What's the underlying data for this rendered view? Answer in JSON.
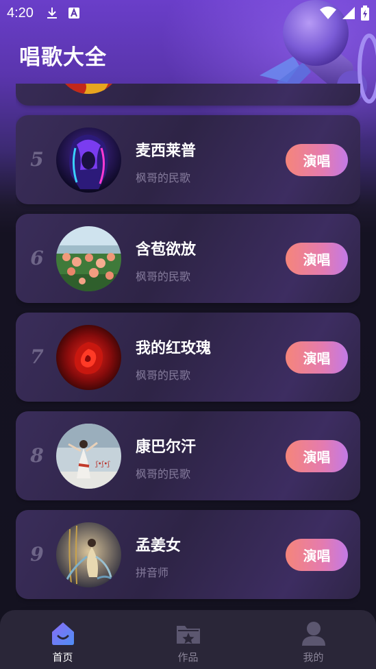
{
  "status_bar": {
    "time": "4:20",
    "left_icons": [
      "download-icon",
      "a11y-icon"
    ],
    "right_icons": [
      "wifi-icon",
      "signal-icon",
      "battery-icon"
    ]
  },
  "app": {
    "title": "唱歌大全"
  },
  "songs": [
    {
      "rank": "5",
      "title": "麦西莱普",
      "artist": "枫哥的民歌",
      "button": "演唱",
      "cover": "neon-portrait-cover"
    },
    {
      "rank": "6",
      "title": "含苞欲放",
      "artist": "枫哥的民歌",
      "button": "演唱",
      "cover": "rose-garden-cover"
    },
    {
      "rank": "7",
      "title": "我的红玫瑰",
      "artist": "枫哥的民歌",
      "button": "演唱",
      "cover": "red-rose-cover"
    },
    {
      "rank": "8",
      "title": "康巴尔汗",
      "artist": "枫哥的民歌",
      "button": "演唱",
      "cover": "dancer-cover"
    },
    {
      "rank": "9",
      "title": "孟姜女",
      "artist": "拼音师",
      "button": "演唱",
      "cover": "fairy-painting-cover"
    }
  ],
  "bottom_nav": {
    "items": [
      {
        "label": "首页",
        "icon": "home-icon",
        "active": true
      },
      {
        "label": "作品",
        "icon": "works-folder-icon",
        "active": false
      },
      {
        "label": "我的",
        "icon": "profile-icon",
        "active": false
      }
    ]
  },
  "colors": {
    "header_purple": "#6a3ec9",
    "background": "#141220",
    "card": "#2e2446",
    "button_start": "#f5857a",
    "button_end": "#c27ae6",
    "nav_bar": "#2a2638",
    "active_icon": "#6a7cf5"
  }
}
